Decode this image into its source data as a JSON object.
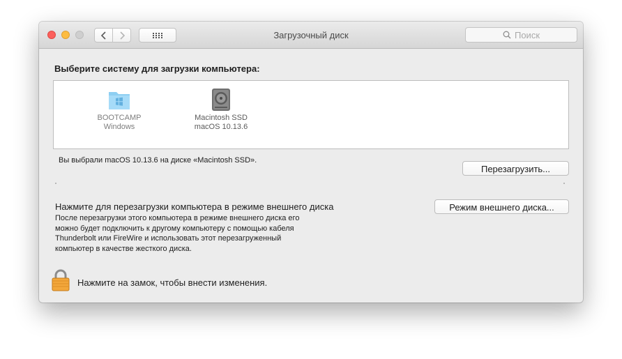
{
  "window": {
    "title": "Загрузочный диск"
  },
  "toolbar": {
    "back_icon": "chevron-left-icon",
    "forward_icon": "chevron-right-icon",
    "grid_icon": "grid-dots-icon"
  },
  "search": {
    "placeholder": "Поиск",
    "icon": "search-icon"
  },
  "main": {
    "heading": "Выберите систему для загрузки компьютера:",
    "disks": [
      {
        "name": "BOOTCAMP",
        "system": "Windows",
        "icon": "bootcamp-folder-icon"
      },
      {
        "name": "Macintosh SSD",
        "system": "macOS 10.13.6",
        "icon": "hard-disk-icon"
      }
    ],
    "selected_info": "Вы выбрали macOS 10.13.6 на диске «Macintosh SSD».",
    "restart_button": "Перезагрузить..."
  },
  "target_mode": {
    "title": "Нажмите для перезагрузки компьютера в режиме внешнего диска",
    "description_lines": [
      "После перезагрузки этого компьютера в режиме внешнего диска его",
      "можно будет подключить к другому компьютеру с помощью кабеля",
      "Thunderbolt или FireWire и использовать этот перезагруженный",
      "компьютер в качестве жесткого диска."
    ],
    "button": "Режим внешнего диска..."
  },
  "footer": {
    "lock_text": "Нажмите на замок, чтобы внести изменения.",
    "lock_icon": "lock-icon"
  },
  "colors": {
    "close": "#fc605c",
    "minimize": "#fdbc40",
    "zoom": "#cfcfcf",
    "window_bg": "#ececec"
  }
}
